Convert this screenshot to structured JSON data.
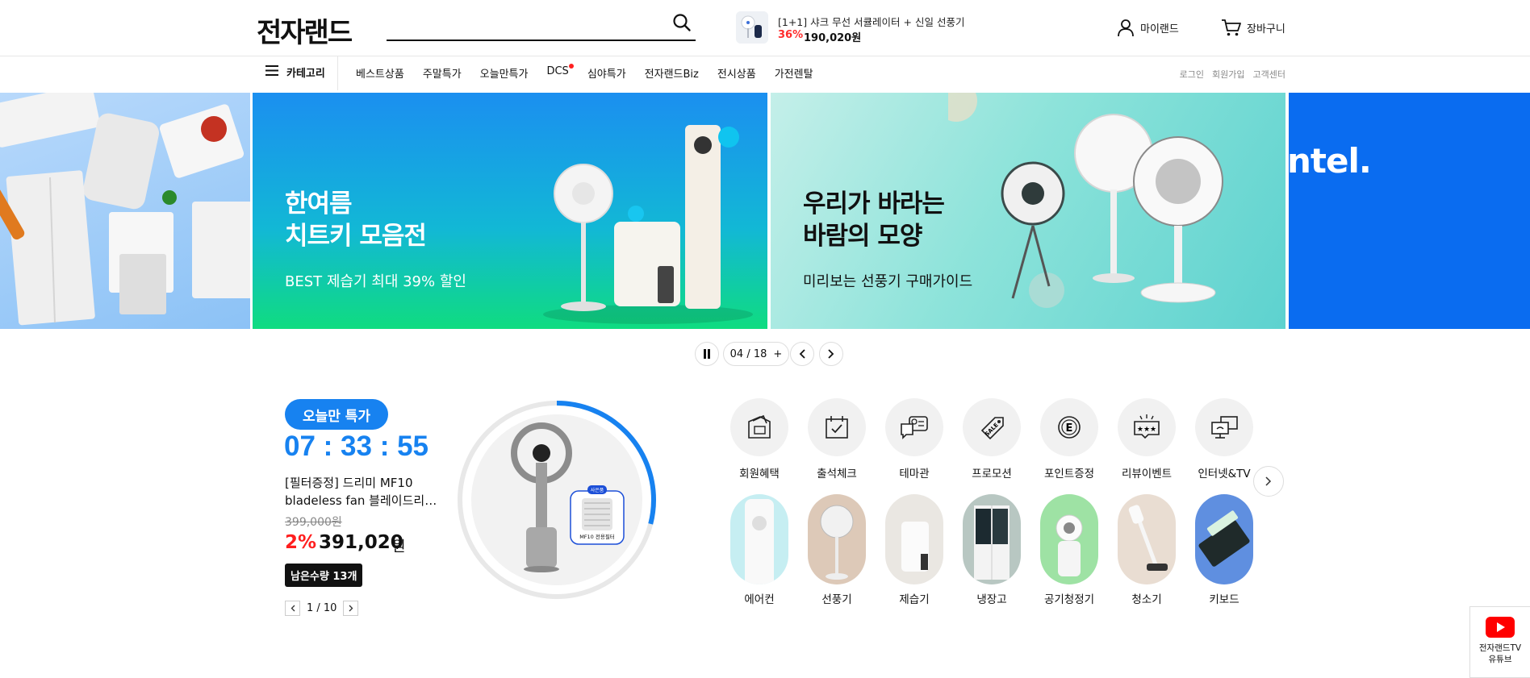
{
  "header": {
    "logo": "전자랜드",
    "search_placeholder": "",
    "promo": {
      "title": "[1+1] 샤크 무선 서큘레이터 + 신일 선풍기",
      "discount": "36%",
      "price": "190,020원"
    },
    "mypage_label": "마이랜드",
    "cart_label": "장바구니"
  },
  "gnb": {
    "category_label": "카테고리",
    "menu": [
      "베스트상품",
      "주말특가",
      "오늘만특가",
      "DCS",
      "심야특가",
      "전자랜드Biz",
      "전시상품",
      "가전렌탈"
    ],
    "right": [
      "로그인",
      "회원가입",
      "고객센터"
    ]
  },
  "banner": {
    "slide_a": {
      "title_line1": "한여름",
      "title_line2": "치트키 모음전",
      "subtitle": "BEST 제습기 최대 39% 할인"
    },
    "slide_b": {
      "title_line1": "우리가 바라는",
      "title_line2": "바람의 모양",
      "subtitle": "미리보는 선풍기 구매가이드"
    },
    "slide_r_text": "ntel.",
    "pager": {
      "current": "04",
      "separator": "/",
      "total": "18",
      "plus": "+"
    }
  },
  "today_deal": {
    "badge": "오늘만 특가",
    "timer": "07 : 33 : 55",
    "name_line1": "[필터증정] 드리미 MF10",
    "name_line2": "bladeless fan 블레이드리스 팬...",
    "original_price": "399,000원",
    "discount": "2%",
    "price": "391,020",
    "won": "원",
    "remaining": "남은수량 13개",
    "pager": "1 / 10",
    "badge_small": "사은품",
    "gift_label": "MF10 전용필터",
    "timer_progress": 0.29
  },
  "quick_menu": [
    {
      "label": "회원혜택",
      "icon": "gift-box-icon"
    },
    {
      "label": "출석체크",
      "icon": "calendar-check-icon"
    },
    {
      "label": "테마관",
      "icon": "chat-bubble-icon"
    },
    {
      "label": "프로모션",
      "icon": "sale-tag-icon"
    },
    {
      "label": "포인트증정",
      "icon": "point-coin-icon"
    },
    {
      "label": "리뷰이벤트",
      "icon": "review-stars-icon"
    },
    {
      "label": "인터넷&TV",
      "icon": "internet-tv-icon"
    }
  ],
  "categories": [
    {
      "label": "에어컨"
    },
    {
      "label": "선풍기"
    },
    {
      "label": "제습기"
    },
    {
      "label": "냉장고"
    },
    {
      "label": "공기청정기"
    },
    {
      "label": "청소기"
    },
    {
      "label": "키보드"
    }
  ],
  "youtube": {
    "line1": "전자랜드TV",
    "line2": "유튜브"
  },
  "colors": {
    "accent": "#1782f0",
    "sale_red": "#ff1e1e",
    "dot_red": "#ff2020"
  }
}
